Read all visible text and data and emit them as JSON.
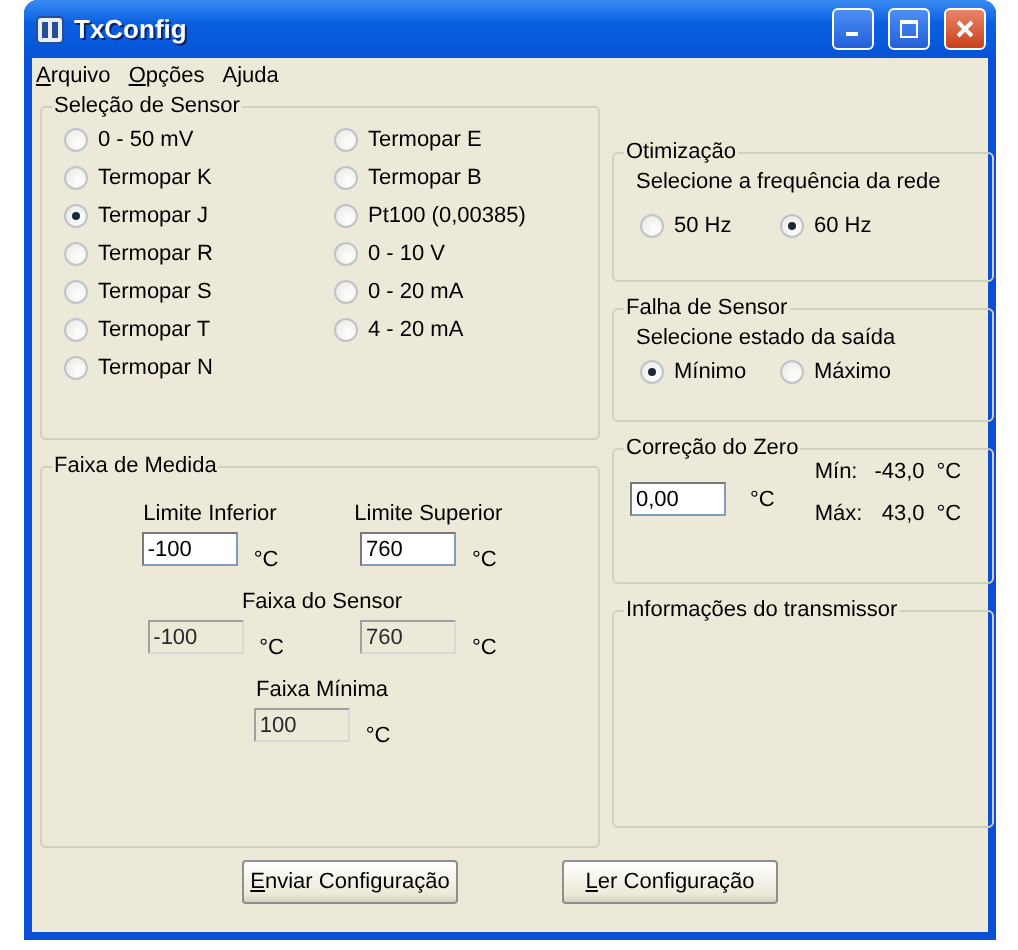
{
  "window": {
    "title": "TxConfig"
  },
  "menu": [
    {
      "label": "Arquivo"
    },
    {
      "label": "Opções"
    },
    {
      "label": "Ajuda"
    }
  ],
  "sensor": {
    "title": "Seleção de Sensor",
    "options": [
      {
        "label": "0 - 50 mV",
        "selected": false
      },
      {
        "label": "Termopar K",
        "selected": false
      },
      {
        "label": "Termopar J",
        "selected": true
      },
      {
        "label": "Termopar R",
        "selected": false
      },
      {
        "label": "Termopar S",
        "selected": false
      },
      {
        "label": "Termopar T",
        "selected": false
      },
      {
        "label": "Termopar N",
        "selected": false
      },
      {
        "label": "Termopar E",
        "selected": false
      },
      {
        "label": "Termopar B",
        "selected": false
      },
      {
        "label": "Pt100 (0,00385)",
        "selected": false
      },
      {
        "label": "0 - 10 V",
        "selected": false
      },
      {
        "label": "0 - 20 mA",
        "selected": false
      },
      {
        "label": "4 - 20 mA",
        "selected": false
      }
    ]
  },
  "range": {
    "title": "Faixa de Medida",
    "limits": [
      {
        "label": "Limite Inferior",
        "value": "-100",
        "unit": "°C"
      },
      {
        "label": "Limite Superior",
        "value": "760",
        "unit": "°C"
      }
    ],
    "sensor_range": {
      "label": "Faixa do Sensor",
      "fields": [
        {
          "value": "-100",
          "unit": "°C",
          "disabled": true
        },
        {
          "value": "760",
          "unit": "°C",
          "disabled": true
        }
      ]
    },
    "min_span": {
      "label": "Faixa Mínima",
      "value": "100",
      "unit": "°C",
      "disabled": true
    }
  },
  "optimization": {
    "title": "Otimização",
    "prompt": "Selecione a frequência da rede",
    "options": [
      {
        "label": "50 Hz",
        "selected": false
      },
      {
        "label": "60 Hz",
        "selected": true
      }
    ]
  },
  "sensor_failure": {
    "title": "Falha de Sensor",
    "prompt": "Selecione estado da saída",
    "options": [
      {
        "label": "Mínimo",
        "selected": true
      },
      {
        "label": "Máximo",
        "selected": false
      }
    ]
  },
  "zero": {
    "title": "Correção do Zero",
    "value": "0,00",
    "unit": "°C",
    "limits": [
      {
        "label": "Mín:",
        "value": "-43,0",
        "unit": "°C"
      },
      {
        "label": "Máx:",
        "value": "43,0",
        "unit": "°C"
      }
    ]
  },
  "info": {
    "title": "Informações do transmissor"
  },
  "buttons": [
    {
      "label": "Enviar Configuração"
    },
    {
      "label": "Ler Configuração"
    }
  ]
}
